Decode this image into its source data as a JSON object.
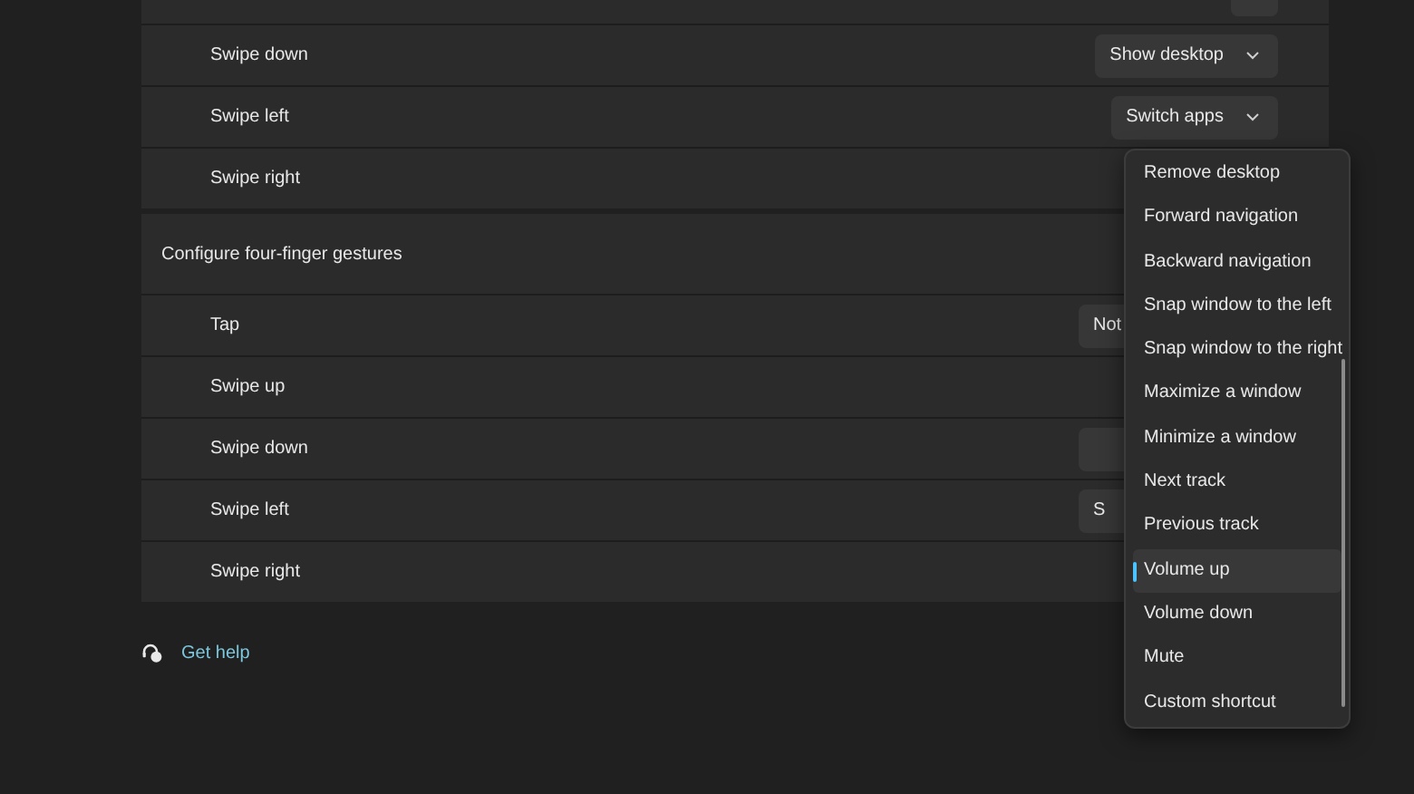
{
  "three_finger_rows": [
    {
      "kind": "dropdown"
    },
    {
      "label": "Swipe down",
      "value": "Show desktop"
    },
    {
      "label": "Swipe left",
      "value": "Switch apps"
    },
    {
      "label": "Swipe right"
    }
  ],
  "four_finger_section": {
    "title": "Configure four-finger gestures",
    "rows": [
      {
        "label": "Tap",
        "kind": "dropdown",
        "value": "Not"
      },
      {
        "label": "Swipe up",
        "kind": "plain"
      },
      {
        "label": "Swipe down",
        "kind": "dropdown"
      },
      {
        "label": "Swipe left",
        "kind": "dropdown",
        "value": "S"
      },
      {
        "label": "Swipe right",
        "kind": "plain"
      }
    ]
  },
  "dropdown_menu": {
    "items": [
      {
        "label": "Remove desktop",
        "selected": false
      },
      {
        "label": "Forward navigation",
        "selected": false
      },
      {
        "label": "Backward navigation",
        "selected": false
      },
      {
        "label": "Snap window to the left",
        "selected": false
      },
      {
        "label": "Snap window to the right",
        "selected": false
      },
      {
        "label": "Maximize a window",
        "selected": false
      },
      {
        "label": "Minimize a window",
        "selected": false
      },
      {
        "label": "Next track",
        "selected": false
      },
      {
        "label": "Previous track",
        "selected": false
      },
      {
        "label": "Volume up",
        "selected": true
      },
      {
        "label": "Volume down",
        "selected": false
      },
      {
        "label": "Mute",
        "selected": false
      },
      {
        "label": "Custom shortcut",
        "selected": false
      }
    ]
  },
  "help_link": "Get help"
}
